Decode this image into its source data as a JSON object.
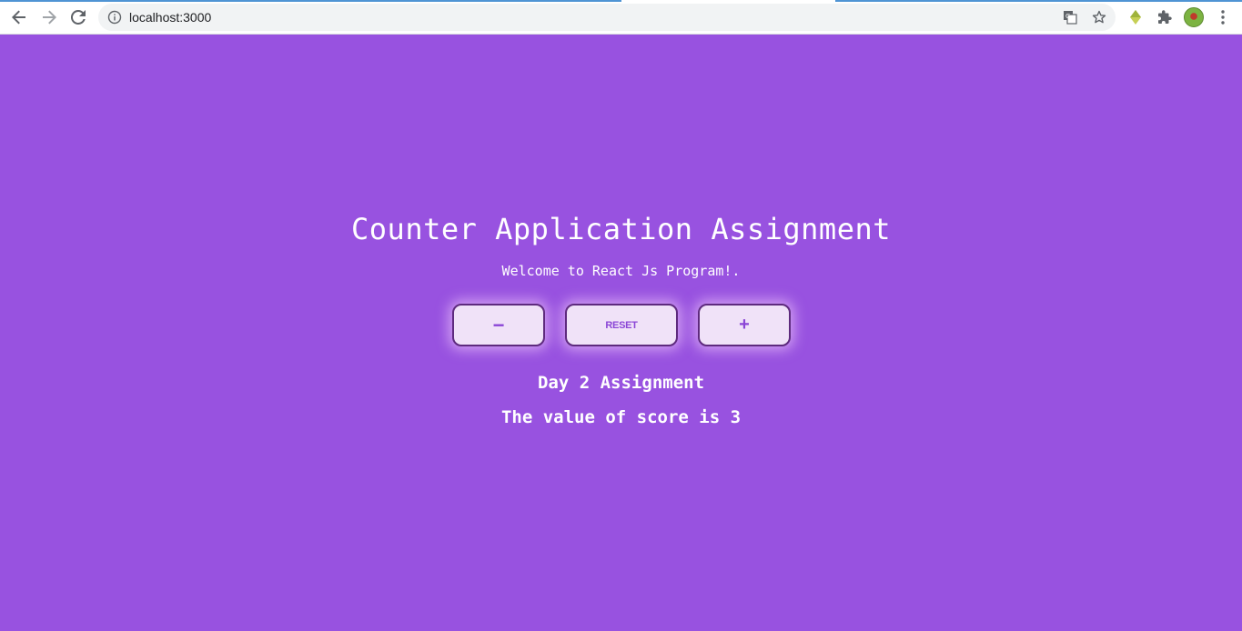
{
  "browser": {
    "url": "localhost:3000",
    "icons": [
      "back-icon",
      "forward-icon",
      "reload-icon",
      "info-icon",
      "translate-icon",
      "bookmark-star-icon",
      "extension-diamond-icon",
      "extensions-puzzle-icon",
      "profile-avatar",
      "menu-dots-icon"
    ]
  },
  "app": {
    "title": "Counter Application Assignment",
    "subtitle": "Welcome to React Js Program!.",
    "buttons": {
      "decrement": "−",
      "reset": "RESET",
      "increment": "+"
    },
    "day_label": "Day 2 Assignment",
    "score_text": "The value of score is 3"
  },
  "colors": {
    "background": "#9852e0",
    "button_fill": "#f0e2f8",
    "button_border": "#5e2a7e",
    "button_text": "#8b46d6",
    "text": "#ffffff"
  }
}
